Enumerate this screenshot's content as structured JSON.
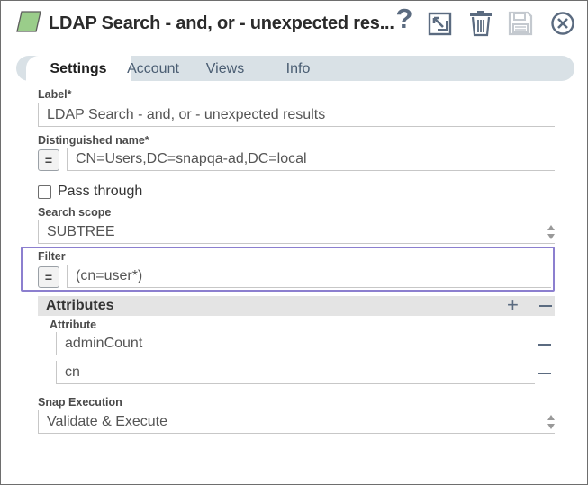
{
  "header": {
    "title": "LDAP Search - and, or - unexpected res...",
    "help_glyph": "?",
    "icons": [
      "snap-type-icon",
      "help-icon",
      "export-icon",
      "delete-icon",
      "save-icon",
      "close-icon"
    ],
    "accent_color": "#8c7fcf",
    "snap_icon_color": "#9acd8a"
  },
  "tabs": [
    {
      "label": "Settings",
      "active": true
    },
    {
      "label": "Account",
      "active": false
    },
    {
      "label": "Views",
      "active": false
    },
    {
      "label": "Info",
      "active": false
    }
  ],
  "form": {
    "label": {
      "name": "Label*",
      "value": "LDAP Search - and, or - unexpected results"
    },
    "dn": {
      "name": "Distinguished name*",
      "value": "CN=Users,DC=snapqa-ad,DC=local",
      "expr_glyph": "="
    },
    "pass_through": {
      "name": "Pass through",
      "checked": false
    },
    "scope": {
      "name": "Search scope",
      "value": "SUBTREE"
    },
    "filter": {
      "name": "Filter",
      "value": "(cn=user*)",
      "expr_glyph": "="
    },
    "attributes": {
      "title": "Attributes",
      "column": "Attribute",
      "add_glyph": "+",
      "rows": [
        {
          "value": "adminCount"
        },
        {
          "value": "cn"
        }
      ]
    },
    "execution": {
      "name": "Snap Execution",
      "value": "Validate & Execute"
    }
  }
}
